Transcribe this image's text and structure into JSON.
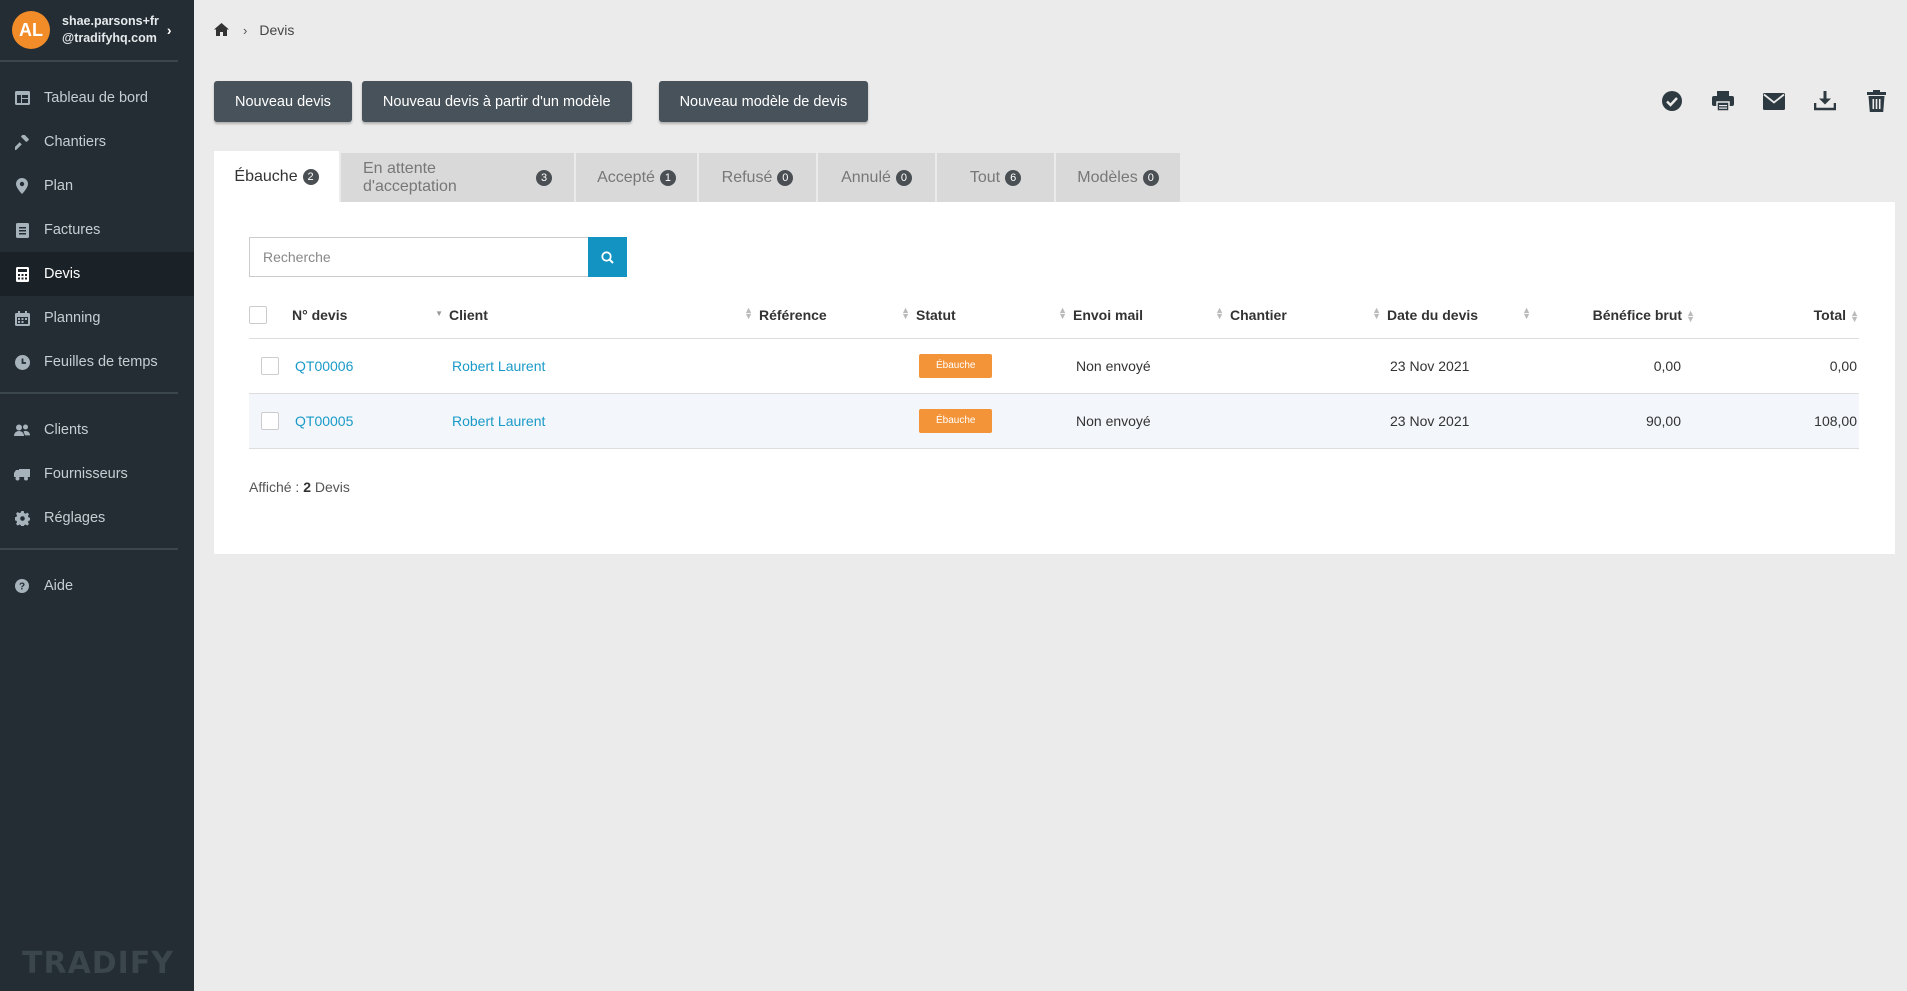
{
  "user": {
    "initials": "AL",
    "email_line1": "shae.parsons+fr",
    "email_line2": "@tradifyhq.com"
  },
  "nav": {
    "group1": [
      {
        "label": "Tableau de bord",
        "icon": "dashboard-icon"
      },
      {
        "label": "Chantiers",
        "icon": "hammer-icon"
      },
      {
        "label": "Plan",
        "icon": "map-marker-icon"
      },
      {
        "label": "Factures",
        "icon": "invoice-icon"
      },
      {
        "label": "Devis",
        "icon": "calculator-icon",
        "active": true
      },
      {
        "label": "Planning",
        "icon": "calendar-icon"
      },
      {
        "label": "Feuilles de temps",
        "icon": "clock-icon"
      }
    ],
    "group2": [
      {
        "label": "Clients",
        "icon": "users-icon"
      },
      {
        "label": "Fournisseurs",
        "icon": "truck-icon"
      },
      {
        "label": "Réglages",
        "icon": "gear-icon"
      }
    ],
    "group3": [
      {
        "label": "Aide",
        "icon": "question-icon"
      }
    ]
  },
  "brand": "TRADIFY",
  "breadcrumb": {
    "current": "Devis"
  },
  "actions": {
    "new_quote": "Nouveau devis",
    "new_from_template": "Nouveau devis à partir d'un modèle",
    "new_template": "Nouveau modèle de devis"
  },
  "toolbar": [
    "check-circle-icon",
    "print-icon",
    "envelope-icon",
    "download-icon",
    "trash-icon"
  ],
  "tabs": [
    {
      "label": "Ébauche",
      "count": "2",
      "active": true
    },
    {
      "label": "En attente d'acceptation",
      "count": "3"
    },
    {
      "label": "Accepté",
      "count": "1"
    },
    {
      "label": "Refusé",
      "count": "0"
    },
    {
      "label": "Annulé",
      "count": "0"
    },
    {
      "label": "Tout",
      "count": "6"
    },
    {
      "label": "Modèles",
      "count": "0"
    }
  ],
  "search": {
    "placeholder": "Recherche"
  },
  "table": {
    "headers": {
      "number": "N° devis",
      "client": "Client",
      "reference": "Référence",
      "status": "Statut",
      "email": "Envoi mail",
      "job": "Chantier",
      "date": "Date du devis",
      "profit": "Bénéfice brut",
      "total": "Total"
    },
    "rows": [
      {
        "number": "QT00006",
        "client": "Robert Laurent",
        "reference": "",
        "status": "Ébauche",
        "email": "Non envoyé",
        "job": "",
        "date": "23 Nov 2021",
        "profit": "0,00",
        "total": "0,00"
      },
      {
        "number": "QT00005",
        "client": "Robert Laurent",
        "reference": "",
        "status": "Ébauche",
        "email": "Non envoyé",
        "job": "",
        "date": "23 Nov 2021",
        "profit": "90,00",
        "total": "108,00"
      }
    ]
  },
  "footer": {
    "label": "Affiché : ",
    "count": "2",
    "suffix": " Devis"
  },
  "colors": {
    "sidebar": "#232d33",
    "accent": "#1293c1",
    "status_draft": "#f39438",
    "button": "#47525a"
  }
}
